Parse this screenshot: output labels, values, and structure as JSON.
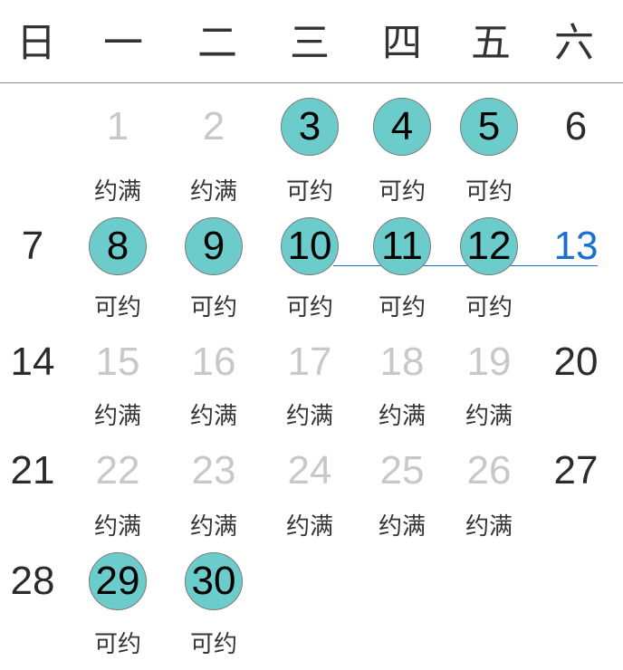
{
  "weekdays": [
    "日",
    "一",
    "二",
    "三",
    "四",
    "五",
    "六"
  ],
  "status_labels": {
    "available": "可约",
    "full": "约满"
  },
  "colors": {
    "available_circle": "#6ccccc",
    "full_text": "#c8c8c8",
    "today_text": "#1a6fd1",
    "normal_text": "#2b2b2b"
  },
  "days": [
    {
      "day": "1",
      "state": "full",
      "status": "约满"
    },
    {
      "day": "2",
      "state": "full",
      "status": "约满"
    },
    {
      "day": "3",
      "state": "available",
      "status": "可约"
    },
    {
      "day": "4",
      "state": "available",
      "status": "可约"
    },
    {
      "day": "5",
      "state": "available",
      "status": "可约"
    },
    {
      "day": "6",
      "state": "weekend",
      "status": ""
    },
    {
      "day": "7",
      "state": "weekend",
      "status": ""
    },
    {
      "day": "8",
      "state": "available",
      "status": "可约"
    },
    {
      "day": "9",
      "state": "available",
      "status": "可约"
    },
    {
      "day": "10",
      "state": "available",
      "status": "可约"
    },
    {
      "day": "11",
      "state": "available",
      "status": "可约"
    },
    {
      "day": "12",
      "state": "available",
      "status": "可约"
    },
    {
      "day": "13",
      "state": "today",
      "status": ""
    },
    {
      "day": "14",
      "state": "weekend",
      "status": ""
    },
    {
      "day": "15",
      "state": "full",
      "status": "约满"
    },
    {
      "day": "16",
      "state": "full",
      "status": "约满"
    },
    {
      "day": "17",
      "state": "full",
      "status": "约满"
    },
    {
      "day": "18",
      "state": "full",
      "status": "约满"
    },
    {
      "day": "19",
      "state": "full",
      "status": "约满"
    },
    {
      "day": "20",
      "state": "weekend",
      "status": ""
    },
    {
      "day": "21",
      "state": "weekend",
      "status": ""
    },
    {
      "day": "22",
      "state": "full",
      "status": "约满"
    },
    {
      "day": "23",
      "state": "full",
      "status": "约满"
    },
    {
      "day": "24",
      "state": "full",
      "status": "约满"
    },
    {
      "day": "25",
      "state": "full",
      "status": "约满"
    },
    {
      "day": "26",
      "state": "full",
      "status": "约满"
    },
    {
      "day": "27",
      "state": "weekend",
      "status": ""
    },
    {
      "day": "28",
      "state": "weekend",
      "status": ""
    },
    {
      "day": "29",
      "state": "available",
      "status": "可约"
    },
    {
      "day": "30",
      "state": "available",
      "status": "可约"
    }
  ]
}
